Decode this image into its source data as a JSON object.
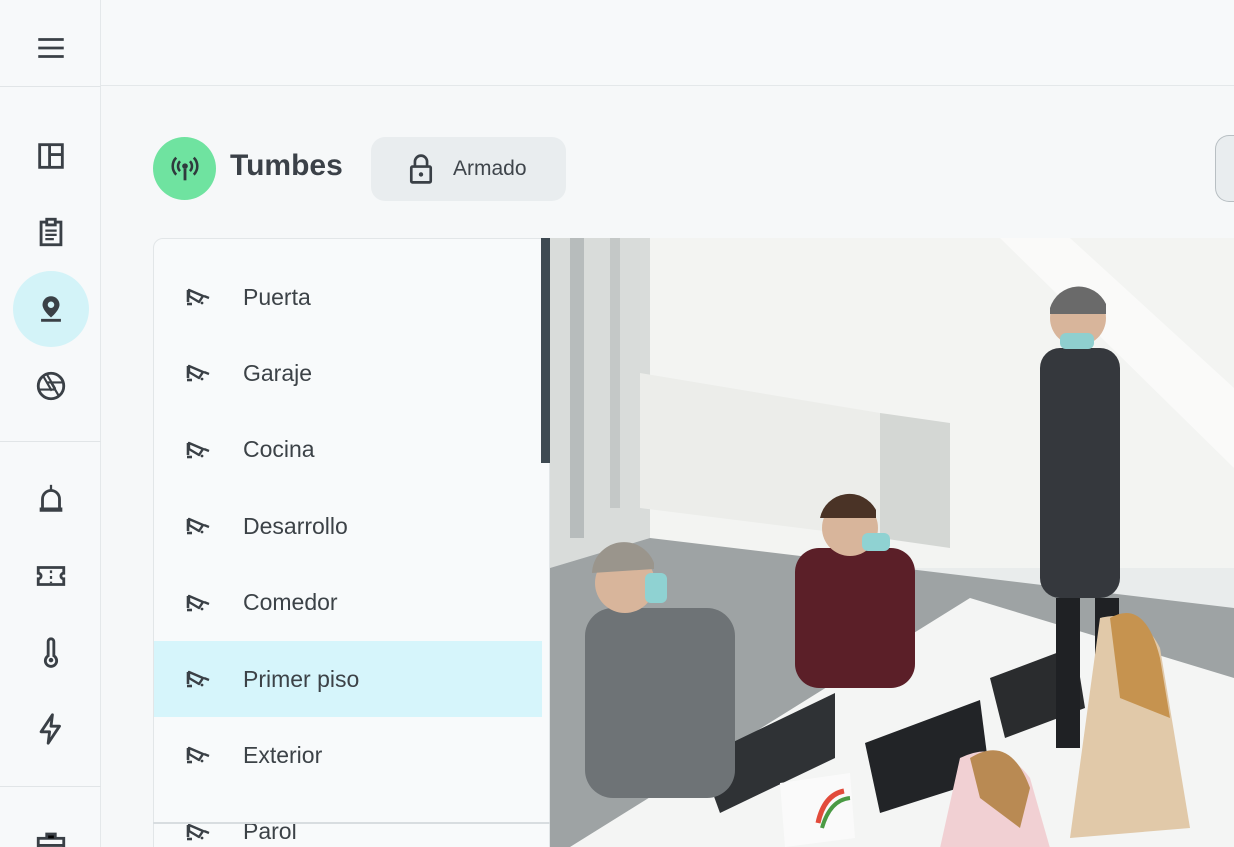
{
  "rail": {
    "items": [
      {
        "icon": "menu-icon"
      },
      {
        "icon": "dashboard-icon"
      },
      {
        "icon": "clipboard-icon"
      },
      {
        "icon": "location-pin-icon",
        "active": true
      },
      {
        "icon": "camera-shutter-icon"
      },
      {
        "icon": "alarm-siren-icon"
      },
      {
        "icon": "ticket-icon"
      },
      {
        "icon": "thermometer-icon"
      },
      {
        "icon": "lightning-icon"
      },
      {
        "icon": "toolbox-icon"
      }
    ]
  },
  "header": {
    "site_icon": "antenna-icon",
    "site_name": "Tumbes",
    "status_icon": "lock-icon",
    "status_label": "Armado"
  },
  "cameras": {
    "items": [
      {
        "label": "Puerta"
      },
      {
        "label": "Garaje"
      },
      {
        "label": "Cocina"
      },
      {
        "label": "Desarrollo"
      },
      {
        "label": "Comedor"
      },
      {
        "label": "Primer piso",
        "selected": true
      },
      {
        "label": "Exterior"
      },
      {
        "label": "Parol"
      }
    ]
  },
  "colors": {
    "accent_active": "#d3f3f8",
    "selected_row": "#d6f5fb",
    "site_badge": "#6fe3a0",
    "icon": "#3a4046"
  }
}
